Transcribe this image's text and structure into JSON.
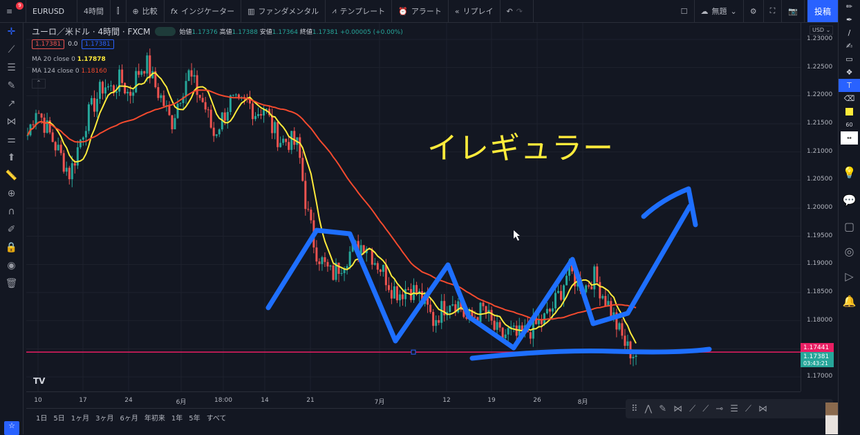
{
  "topbar": {
    "menu_badge": "9",
    "symbol": "EURUSD",
    "interval": "4時間",
    "compare": "比較",
    "indicators": "インジケーター",
    "fundamentals": "ファンダメンタル",
    "templates": "テンプレート",
    "alert": "アラート",
    "replay": "リプレイ",
    "layout_name": "無題",
    "post": "投稿"
  },
  "legend": {
    "title": "ユーロ／米ドル · 4時間 · FXCM",
    "open_label": "始値",
    "open": "1.17376",
    "high_label": "高値",
    "high": "1.17388",
    "low_label": "安値",
    "low": "1.17364",
    "close_label": "終値",
    "close": "1.17381",
    "change": "+0.00005 (+0.00%)",
    "sell": "1.17381",
    "spread": "0.0",
    "buy": "1.17381",
    "ma20_label": "MA 20 close 0",
    "ma20": "1.17878",
    "ma124_label": "MA 124 close 0",
    "ma124": "1.18160"
  },
  "annotation": "イレギュラー",
  "price_axis": {
    "currency": "USD",
    "labels": [
      "1.23000",
      "1.22500",
      "1.22000",
      "1.21500",
      "1.21000",
      "1.20500",
      "1.20000",
      "1.19500",
      "1.19000",
      "1.18500",
      "1.18000",
      "1.17500",
      "1.17000"
    ],
    "hline_price": "1.17441",
    "last_price": "1.17381",
    "countdown": "03:43:21"
  },
  "time_axis": [
    "10",
    "17",
    "24",
    "6月",
    "18:00",
    "14",
    "21",
    "7月",
    "12",
    "19",
    "26",
    "8月"
  ],
  "ranges": [
    "1日",
    "5日",
    "1ヶ月",
    "3ヶ月",
    "6ヶ月",
    "年初来",
    "1年",
    "5年",
    "すべて"
  ],
  "chart_data": {
    "type": "candlestick",
    "symbol": "EURUSD",
    "ylim": [
      1.17,
      1.23
    ],
    "closes": [
      1.213,
      1.218,
      1.215,
      1.212,
      1.209,
      1.206,
      1.211,
      1.216,
      1.219,
      1.222,
      1.221,
      1.223,
      1.22,
      1.224,
      1.226,
      1.222,
      1.219,
      1.215,
      1.22,
      1.224,
      1.221,
      1.218,
      1.213,
      1.216,
      1.219,
      1.218,
      1.219,
      1.217,
      1.218,
      1.214,
      1.212,
      1.212,
      1.211,
      1.2,
      1.193,
      1.19,
      1.188,
      1.19,
      1.192,
      1.193,
      1.194,
      1.191,
      1.189,
      1.186,
      1.185,
      1.186,
      1.185,
      1.183,
      1.18,
      1.182,
      1.184,
      1.183,
      1.18,
      1.181,
      1.182,
      1.179,
      1.177,
      1.178,
      1.177,
      1.178,
      1.179,
      1.18,
      1.182,
      1.185,
      1.189,
      1.187,
      1.186,
      1.188,
      1.185,
      1.182,
      1.178,
      1.175,
      1.1738
    ],
    "hline": 1.17441
  },
  "colors": {
    "up": "#26a69a",
    "down": "#ef5350",
    "ma20": "#ffeb3b",
    "ma124": "#f44a2e",
    "hline": "#e91e63",
    "drawing": "#1e6fff",
    "accent": "#2962ff"
  }
}
